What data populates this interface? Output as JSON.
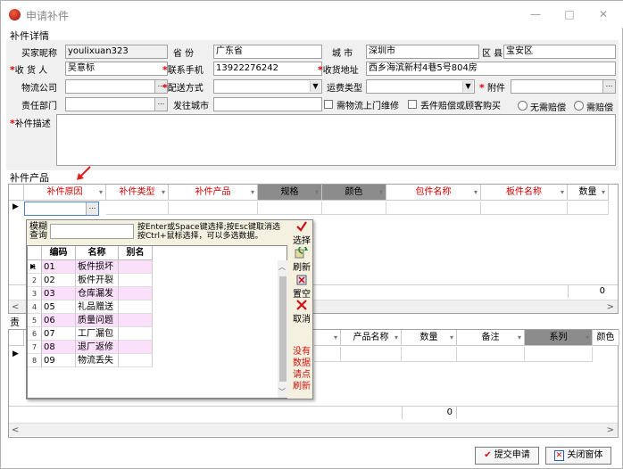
{
  "window": {
    "title": "申请补件",
    "minimize": "—",
    "maximize": "□",
    "close": "✕"
  },
  "details": {
    "section_title": "补件详情",
    "buyer_nick_label": "买家昵称",
    "buyer_nick": "youlixuan323",
    "province_label": "省   份",
    "province": "广东省",
    "city_label": "城 市",
    "city": "深圳市",
    "district_label": "区 县",
    "district": "宝安区",
    "receiver_label": "收 货 人",
    "receiver": "吴意标",
    "phone_label": "联系手机",
    "phone": "13922276242",
    "address_label": "收货地址",
    "address": "西乡海滨新村4巷5号804房",
    "logistics_label": "物流公司",
    "logistics": "",
    "delivery_label": "配送方式",
    "delivery": "",
    "freight_type_label": "运费类型",
    "freight_type": "",
    "attachment_label": "附件",
    "attachment": "",
    "dept_label": "责任部门",
    "dept": "",
    "ship_city_label": "发往城市",
    "ship_city": "",
    "need_repair_label": "需物流上门维修",
    "lost_comp_label": "丢件赔偿或顾客购买",
    "no_comp_label": "无需赔偿",
    "need_comp_label": "需赔偿",
    "desc_label": "补件描述",
    "desc": ""
  },
  "products": {
    "section_title": "补件产品",
    "columns": [
      {
        "label": "补件原因",
        "red": true,
        "dark": false
      },
      {
        "label": "补件类型",
        "red": true,
        "dark": false
      },
      {
        "label": "补件产品",
        "red": true,
        "dark": false
      },
      {
        "label": "规格",
        "red": false,
        "dark": true
      },
      {
        "label": "颜色",
        "red": false,
        "dark": true
      },
      {
        "label": "包件名称",
        "red": true,
        "dark": false
      },
      {
        "label": "板件名称",
        "red": true,
        "dark": false
      },
      {
        "label": "数量",
        "red": false,
        "dark": false
      }
    ],
    "total_qty": "0"
  },
  "resp": {
    "section_title": "责",
    "columns": [
      {
        "label": "产品名称",
        "dark": false
      },
      {
        "label": "数量",
        "dark": false
      },
      {
        "label": "备注",
        "dark": false
      },
      {
        "label": "系列",
        "dark": true
      },
      {
        "label": "颜色",
        "dark": false
      }
    ],
    "total_qty": "0"
  },
  "popup": {
    "fuzzy_label": "模糊",
    "query_label": "查询",
    "hint_line1": "按Enter或Space键选择;按Esc键取消选",
    "hint_line2": "按Ctrl+鼠标选择，可以多选数据。",
    "col_code": "编码",
    "col_name": "名称",
    "col_alias": "别名",
    "rows": [
      {
        "no": "1",
        "code": "01",
        "name": "板件损坏",
        "pink": true
      },
      {
        "no": "2",
        "code": "02",
        "name": "板件开裂",
        "pink": false
      },
      {
        "no": "3",
        "code": "03",
        "name": "仓库漏发",
        "pink": true
      },
      {
        "no": "4",
        "code": "05",
        "name": "礼品赠送",
        "pink": false
      },
      {
        "no": "5",
        "code": "06",
        "name": "质量问题",
        "pink": true
      },
      {
        "no": "6",
        "code": "07",
        "name": "工厂漏包",
        "pink": false
      },
      {
        "no": "7",
        "code": "08",
        "name": "退厂返修",
        "pink": true
      },
      {
        "no": "8",
        "code": "09",
        "name": "物流丢失",
        "pink": false
      }
    ],
    "btn_select": "选择",
    "btn_refresh": "刷新",
    "btn_clear": "置空",
    "btn_cancel": "取消",
    "no_data_line1": "没有",
    "no_data_line2": "数据",
    "no_data_line3": "请点",
    "no_data_line4": "刷新"
  },
  "footer": {
    "submit_label": "提交申请",
    "close_label": "关闭窗体"
  },
  "colors": {
    "required": "#e00000",
    "pink_row": "#fbe0fb",
    "dark_header": "#8c8c8c",
    "popup_bg": "#f4f1e0"
  }
}
